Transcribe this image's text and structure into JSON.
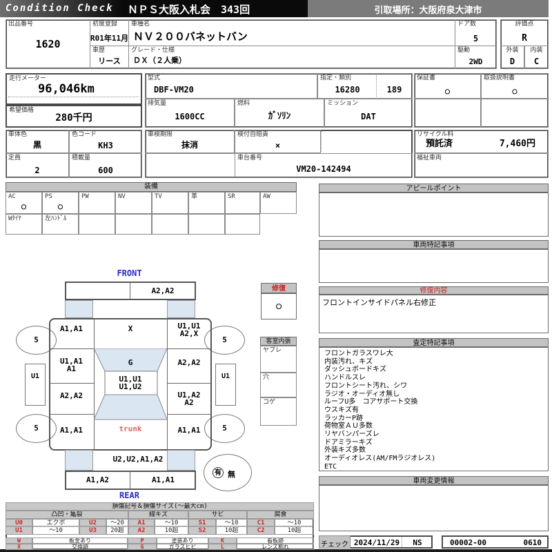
{
  "colors": {
    "title_bar_dark": "#1a1a1a",
    "title_bar_gray": "#7b7b7b",
    "section_bar_gray": "#c3c3c3",
    "accent_red": "#cc2222",
    "glass_blue": "#dbe6f3",
    "label_blue": "#2b2bbf"
  },
  "header": {
    "logo": "Condition Check",
    "title": "ＮＰＳ大阪入札会　343回",
    "pickup": "引取場所：大阪府泉大津市"
  },
  "vehicle": {
    "lot_label": "出品番号",
    "lot": "1620",
    "first_reg_label": "初度登録",
    "first_reg": "R01年11月",
    "model_name_label": "車種名",
    "model_name": "ＮＶ２００バネットバン",
    "doors_label": "ドア数",
    "doors": "5",
    "grade_label": "評価点",
    "grade": "R",
    "history_label": "車歴",
    "history": "リース",
    "spec_label": "グレード・仕様",
    "spec": "ＤＸ（２人乗）",
    "drive_label": "駆動",
    "drive": "2WD",
    "exterior_label": "外装",
    "exterior": "D",
    "interior_label": "内装",
    "interior": "C",
    "odo_label": "走行メーター",
    "odo": "96,046km",
    "price_label": "希望価格",
    "price": "280千円",
    "model_code_label": "型式",
    "model_code": "DBF-VM20",
    "class_label": "指定・類別",
    "class1": "16280",
    "class2": "189",
    "warranty_label": "保証書",
    "warranty_mark": "○",
    "manual_label": "取扱説明書",
    "manual_mark": "○",
    "displacement_label": "排気量",
    "displacement": "1600CC",
    "fuel_label": "燃料",
    "fuel": "ｶﾞｿﾘﾝ",
    "mission_label": "ミッション",
    "mission": "DAT",
    "body_color_label": "車体色",
    "body_color": "黒",
    "color_code_label": "色コード",
    "color_code": "KH3",
    "inspection_label": "車検期限",
    "inspection": "抹消",
    "insurance_label": "検付自賠責",
    "insurance": "×",
    "recycle_label": "リサイクル料",
    "recycle_status": "預託済",
    "recycle_fee": "7,460円",
    "capacity_label": "定員",
    "capacity": "2",
    "load_label": "積載量",
    "load": "600",
    "chassis_label": "車台番号",
    "chassis": "VM20-142494",
    "welfare_label": "福祉車両"
  },
  "equipment": {
    "title": "装備",
    "items": [
      {
        "label": "AC",
        "mark": "○"
      },
      {
        "label": "PS",
        "mark": "○"
      },
      {
        "label": "PW",
        "mark": ""
      },
      {
        "label": "NV",
        "mark": ""
      },
      {
        "label": "TV",
        "mark": ""
      },
      {
        "label": "革",
        "mark": ""
      },
      {
        "label": "SR",
        "mark": ""
      },
      {
        "label": "AW",
        "mark": ""
      }
    ],
    "notes": [
      "Wﾀｲﾔ",
      "左ﾊﾝﾄﾞﾙ"
    ]
  },
  "panels": {
    "appeal": {
      "title": "アピールポイント",
      "content": ""
    },
    "notes": {
      "title": "車両特記事項",
      "content": ""
    },
    "repair": {
      "title": "修復内容",
      "content": "フロントインサイドパネル右修正"
    },
    "assessment": {
      "title": "査定特記事項",
      "items": [
        "フロントガラスワレ大",
        "内装汚れ、キズ",
        "ダッシュボードキズ",
        "ハンドルスレ",
        "フロントシート汚れ、シワ",
        "ラジオ・オーディオ無し",
        "ルーフU多　コアサポート交換",
        "ウスキズ有",
        "ラッカーP跡",
        "荷物室ＡＵ多数",
        "リヤバンパーズレ",
        "ドアミラーキズ",
        "外装キズ多数",
        "オーディオレス(AM/FMラジオレス)",
        "ETC"
      ]
    },
    "change": {
      "title": "車両変更情報",
      "content": ""
    }
  },
  "diagram": {
    "front_label": "FRONT",
    "rear_label": "REAR",
    "bumper_front_right": "A2,A2",
    "fender_left": "A1,A1",
    "hood": "X",
    "fender_right": "U1,U1\nA2,X",
    "door_left": "U1,A1\nA1",
    "windshield": "G",
    "door_right": "A2,A2",
    "roof": "U1,U1\nU1,U2",
    "slide_left": "A2,A2",
    "slide_right": "U1,A2\nA2",
    "quarter_left": "A1,A1",
    "trunk": "trunk",
    "quarter_right": "A1,A1",
    "bumper_rear": "U2,U2,A1,A2",
    "rear_bar_left": "A1,A2",
    "rear_bar_right": "A1,A1",
    "step_left": "U1",
    "step_right": "U1",
    "tire": "5",
    "spare_yes": "有",
    "spare_no": "無",
    "repair_box": {
      "title": "修復",
      "mark": "○"
    },
    "cabin_box": {
      "title": "客室内張",
      "rows": [
        "ヤブレ",
        "穴",
        "コゲ"
      ]
    }
  },
  "legend": {
    "title": "損傷記号＆損傷サイズ(〜最大cm)",
    "groups": [
      "凸凹・亀裂",
      "線キズ",
      "サビ",
      "腐食"
    ],
    "rowA": {
      "c1": "U0",
      "v1": "エクボ",
      "c2": "U2",
      "v2": "〜20",
      "c3": "A1",
      "v3": "〜10",
      "c4": "S1",
      "v4": "〜10",
      "c5": "C1",
      "v5": "〜10"
    },
    "rowB": {
      "c1": "U1",
      "v1": "〜10",
      "c2": "U3",
      "v2": "20超",
      "c3": "A2",
      "v3": "10超",
      "c4": "S2",
      "v4": "10超",
      "c5": "C2",
      "v5": "10超"
    },
    "rowC": {
      "c1": "W",
      "v1": "板金あり",
      "c2": "P",
      "v2": "塗装あり",
      "c3": "K",
      "v3": "看板跡"
    },
    "rowD": {
      "c1": "X",
      "v1": "交換跡",
      "c2": "G",
      "v2": "ガラスヒビ",
      "c3": "L",
      "v3": "レンズ割れ"
    }
  },
  "check": {
    "label": "チェック",
    "date": "2024/11/29",
    "inspector": "NS",
    "code1": "00002-00",
    "code2": "0610"
  }
}
